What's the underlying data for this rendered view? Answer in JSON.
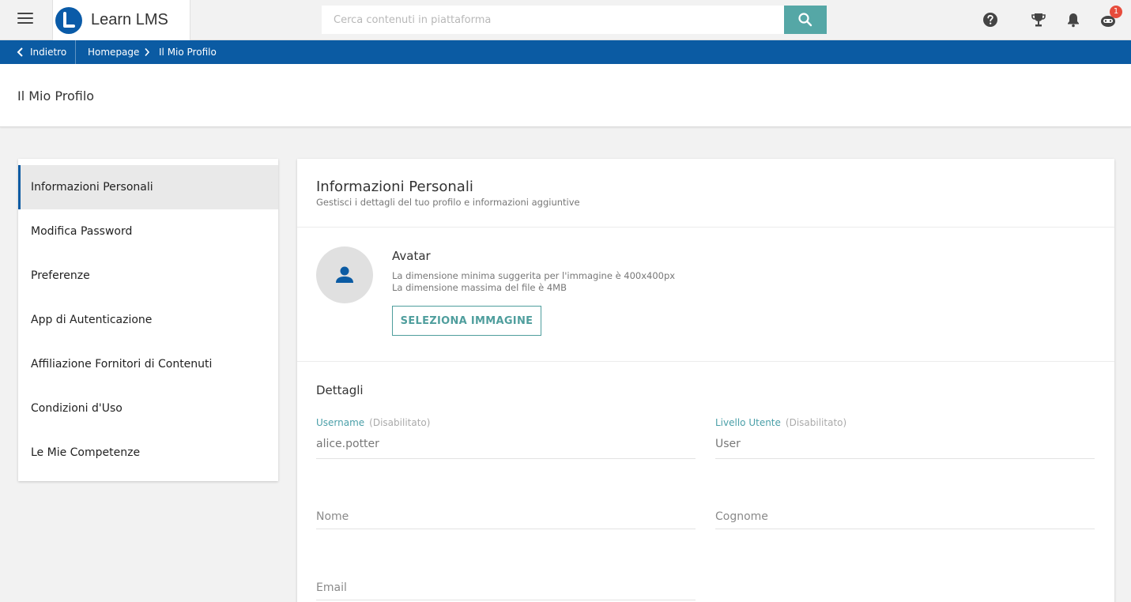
{
  "header": {
    "app_name": "Learn LMS",
    "search_placeholder": "Cerca contenuti in piattaforma",
    "notification_badge": "1",
    "colors": {
      "brand": "#0b5ba3",
      "accent": "#55a7a6",
      "badge": "#e74c3c"
    },
    "icons": [
      "menu-icon",
      "search-icon",
      "help-icon",
      "trophy-icon",
      "bell-icon",
      "chat-bot-icon"
    ]
  },
  "breadcrumb": {
    "back_label": "Indietro",
    "items": [
      "Homepage",
      "Il Mio Profilo"
    ]
  },
  "page": {
    "title": "Il Mio Profilo"
  },
  "sidebar": {
    "items": [
      {
        "label": "Informazioni Personali",
        "active": true
      },
      {
        "label": "Modifica Password",
        "active": false
      },
      {
        "label": "Preferenze",
        "active": false
      },
      {
        "label": "App di Autenticazione",
        "active": false
      },
      {
        "label": "Affiliazione Fornitori di Contenuti",
        "active": false
      },
      {
        "label": "Condizioni d'Uso",
        "active": false
      },
      {
        "label": "Le Mie Competenze",
        "active": false
      }
    ]
  },
  "main": {
    "title": "Informazioni Personali",
    "subtitle": "Gestisci i dettagli del tuo profilo e informazioni aggiuntive",
    "avatar": {
      "title": "Avatar",
      "hint_min": "La dimensione minima suggerita per l'immagine è 400x400px",
      "hint_max": "La dimensione massima del file è 4MB",
      "button_label": "SELEZIONA IMMAGINE"
    },
    "details": {
      "title": "Dettagli",
      "username": {
        "label": "Username",
        "disabled_note": "(Disabilitato)",
        "value": "alice.potter"
      },
      "user_level": {
        "label": "Livello Utente",
        "disabled_note": "(Disabilitato)",
        "value": "User"
      },
      "first_name": {
        "placeholder": "Nome",
        "value": ""
      },
      "last_name": {
        "placeholder": "Cognome",
        "value": ""
      },
      "email": {
        "placeholder": "Email",
        "value": ""
      }
    }
  }
}
